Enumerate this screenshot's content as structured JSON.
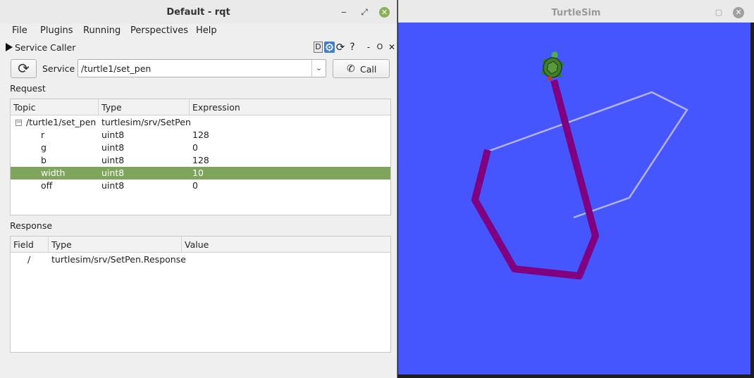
{
  "rqt": {
    "title": "Default - rqt",
    "window_buttons": {
      "minimize": "‒",
      "maximize": "⤢",
      "close": "✕"
    },
    "menu": [
      "File",
      "Plugins",
      "Running",
      "Perspectives",
      "Help"
    ],
    "plugin": {
      "name": "Service Caller",
      "icons": {
        "d": "D",
        "help": "?",
        "reload": "⟳",
        "float": "O",
        "close": "✕",
        "minimize": "-"
      }
    },
    "service": {
      "refresh_icon": "⟳",
      "label": "Service",
      "value": "/turtle1/set_pen",
      "chevron": "⌄",
      "call_icon": "✆",
      "call_label": "Call"
    },
    "request": {
      "label": "Request",
      "columns": [
        "Topic",
        "Type",
        "Expression"
      ],
      "root": {
        "toggle": "−",
        "topic": "/turtle1/set_pen",
        "type": "turtlesim/srv/SetPen",
        "expression": ""
      },
      "rows": [
        {
          "topic": "r",
          "type": "uint8",
          "expression": "128",
          "selected": false
        },
        {
          "topic": "g",
          "type": "uint8",
          "expression": "0",
          "selected": false
        },
        {
          "topic": "b",
          "type": "uint8",
          "expression": "128",
          "selected": false
        },
        {
          "topic": "width",
          "type": "uint8",
          "expression": "10",
          "selected": true
        },
        {
          "topic": "off",
          "type": "uint8",
          "expression": "0",
          "selected": false
        }
      ]
    },
    "response": {
      "label": "Response",
      "columns": [
        "Field",
        "Type",
        "Value"
      ],
      "rows": [
        {
          "field": "/",
          "type": "turtlesim/srv/SetPen.Response",
          "value": ""
        }
      ]
    }
  },
  "turtlesim": {
    "title": "TurtleSim",
    "window_buttons": {
      "maximize": "▢",
      "close": "✕"
    },
    "background_color": "#4556ff",
    "thin_pen_color": "#b3b3ff",
    "thick_pen_color": "#800080"
  }
}
